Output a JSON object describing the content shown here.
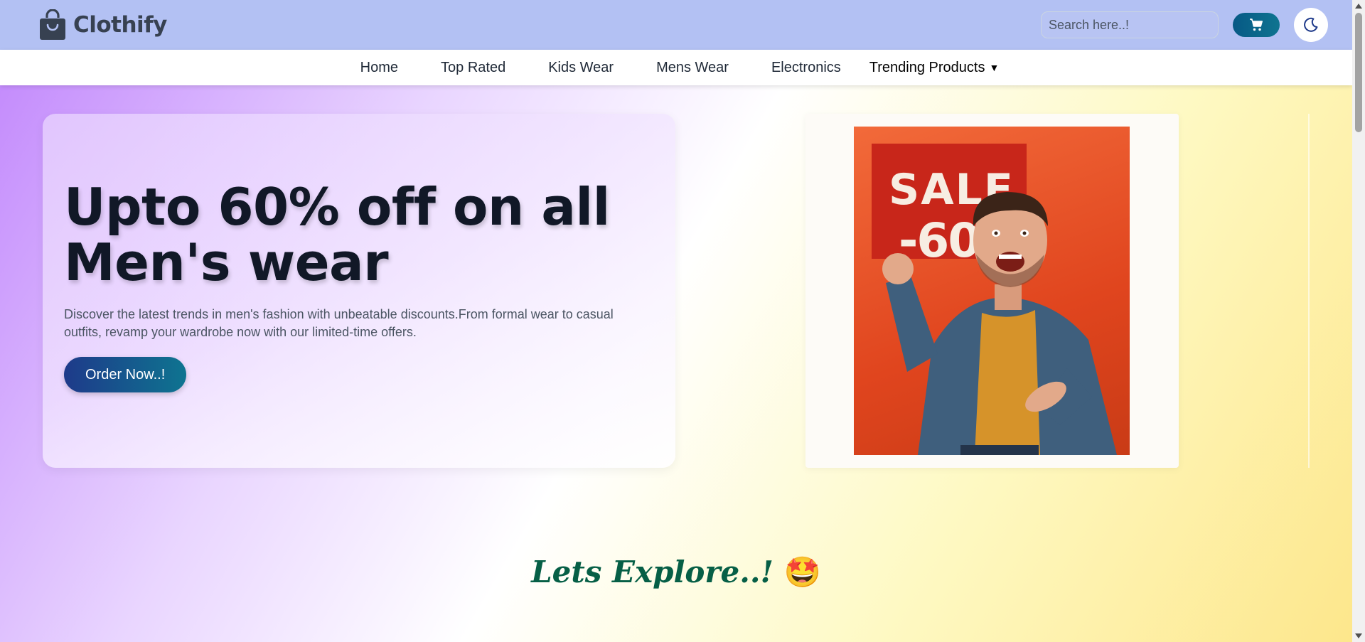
{
  "header": {
    "brand": "Clothify",
    "search_placeholder": "Search here..!",
    "icons": {
      "brand": "shopping-bag-icon",
      "search": "search-icon",
      "cart": "cart-icon",
      "theme": "moon-icon"
    },
    "colors": {
      "header_bg": "#b3c1f3",
      "cart_btn": "#075985"
    }
  },
  "nav": {
    "items": [
      {
        "label": "Home"
      },
      {
        "label": "Top Rated"
      },
      {
        "label": "Kids Wear"
      },
      {
        "label": "Mens Wear"
      },
      {
        "label": "Electronics"
      },
      {
        "label": "Trending Products"
      }
    ],
    "dropdown_icon": "caret-down-icon"
  },
  "hero": {
    "title_line1": "Upto 60% off on all",
    "title_line2": "Men's wear",
    "description": "Discover the latest trends in men's fashion with unbeatable discounts.From formal wear to casual outfits, revamp your wardrobe now with our limited-time offers.",
    "cta": "Order Now..!",
    "poster": {
      "sale_word": "SALE",
      "sale_percent": "-60%"
    }
  },
  "explore": {
    "text": "Lets Explore..!",
    "emoji": "🤩"
  }
}
